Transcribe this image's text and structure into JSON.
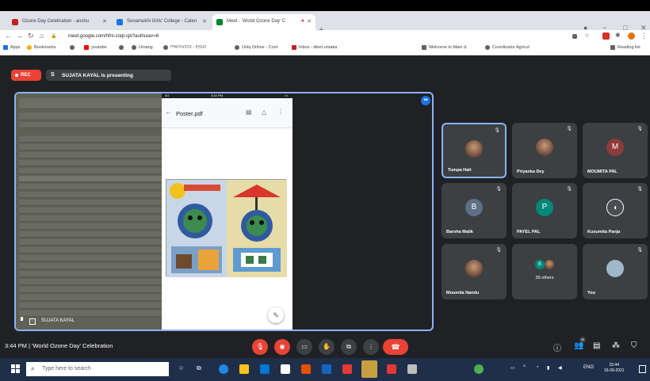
{
  "browser": {
    "tabs": [
      {
        "label": "Ozone Day Celebration - anshu",
        "active": false
      },
      {
        "label": "Sonamukhi Girls' College - Calen",
        "active": false
      },
      {
        "label": "Meet - 'World Ozone Day' C",
        "active": true
      }
    ],
    "url": "meet.google.com/hfm-zoqt-sjb?authuser=6",
    "bookmarks": [
      "Apps",
      "Bookmarks",
      "youtube",
      "Umang",
      "শিক্ষাসমাচার - ইন্ডিয়া",
      "Uniq Online - Cont",
      "Inbox - dkeri.umaka",
      "Welcome to Main d.",
      "Coordinator Agricul",
      "Reading list"
    ],
    "window_controls": {
      "minimize": "−",
      "maximize": "□",
      "close": "✕"
    },
    "new_tab": "+"
  },
  "meet": {
    "rec_label": "REC",
    "presenter_banner": "SUJATA KAYAL is presenting",
    "presenter_initial": "S",
    "stage_label": "SUJATA KAYAL",
    "phone": {
      "status_left": "4G",
      "status_time": "3:44 PM",
      "doc_title": "Poster.pdf"
    },
    "participants": [
      {
        "name": "Tumpa Hait",
        "initial": "",
        "color": "",
        "photo": true,
        "active": true
      },
      {
        "name": "Priyanka Dey",
        "initial": "",
        "color": "",
        "photo": true,
        "active": false
      },
      {
        "name": "MOUMITA PAL",
        "initial": "M",
        "color": "#8e3b3b",
        "photo": false,
        "active": false
      },
      {
        "name": "Barsha Malik",
        "initial": "B",
        "color": "#5f6f88",
        "photo": false,
        "active": false
      },
      {
        "name": "PAYEL PAL",
        "initial": "P",
        "color": "#00897b",
        "photo": false,
        "active": false
      },
      {
        "name": "Kusumita Panja",
        "initial": "",
        "color": "#4a4d52",
        "photo": false,
        "active": false
      },
      {
        "name": "Moumita Nandu",
        "initial": "",
        "color": "",
        "photo": true,
        "active": false
      },
      {
        "name": "",
        "initial": "",
        "color": "",
        "photo": false,
        "active": false,
        "others_count": "39 others"
      },
      {
        "name": "You",
        "initial": "",
        "color": "",
        "photo": true,
        "active": false
      }
    ],
    "meeting_info": "3:44 PM  |  'World Ozone Day' Celebration",
    "people_count": "45"
  },
  "taskbar": {
    "search_placeholder": "Type here to search",
    "time": "15:44",
    "date": "16-09-2021",
    "lang": "ENG"
  }
}
